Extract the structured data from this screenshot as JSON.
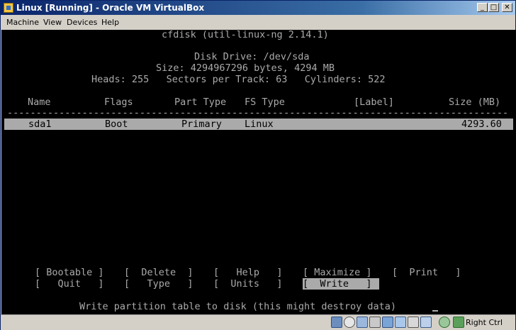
{
  "window": {
    "title": "Linux [Running] - Oracle VM VirtualBox"
  },
  "menu": [
    "Machine",
    "View",
    "Devices",
    "Help"
  ],
  "console": {
    "header": "cfdisk (util-linux-ng 2.14.1)",
    "disk_drive": "Disk Drive: /dev/sda",
    "size_line": "Size: 4294967296 bytes, 4294 MB",
    "geometry": "Heads: 255   Sectors per Track: 63   Cylinders: 522",
    "columns": {
      "name": "Name",
      "flags": "Flags",
      "part_type": "Part Type",
      "fs_type": "FS Type",
      "label": "[Label]",
      "size": "Size (MB)"
    },
    "partition": {
      "name": "sda1",
      "flags": "Boot",
      "part_type": "Primary",
      "fs_type": "Linux",
      "label": "",
      "size": "4293.60"
    },
    "buttons": {
      "bootable": "[ Bootable ]",
      "delete": "[  Delete  ]",
      "help": "[   Help   ]",
      "maximize": "[ Maximize ]",
      "print": "[  Print   ]",
      "quit": "[   Quit   ]",
      "type": "[   Type   ]",
      "units": "[  Units   ]",
      "write": "[  Write   ]"
    },
    "status_message": "Write partition table to disk (this might destroy data)"
  },
  "statusbar": {
    "host_key": "Right Ctrl"
  },
  "colors": {
    "terminal_bg": "#000000",
    "terminal_fg": "#aaaaaa",
    "title_start": "#0a246a",
    "title_end": "#a6caf0"
  }
}
